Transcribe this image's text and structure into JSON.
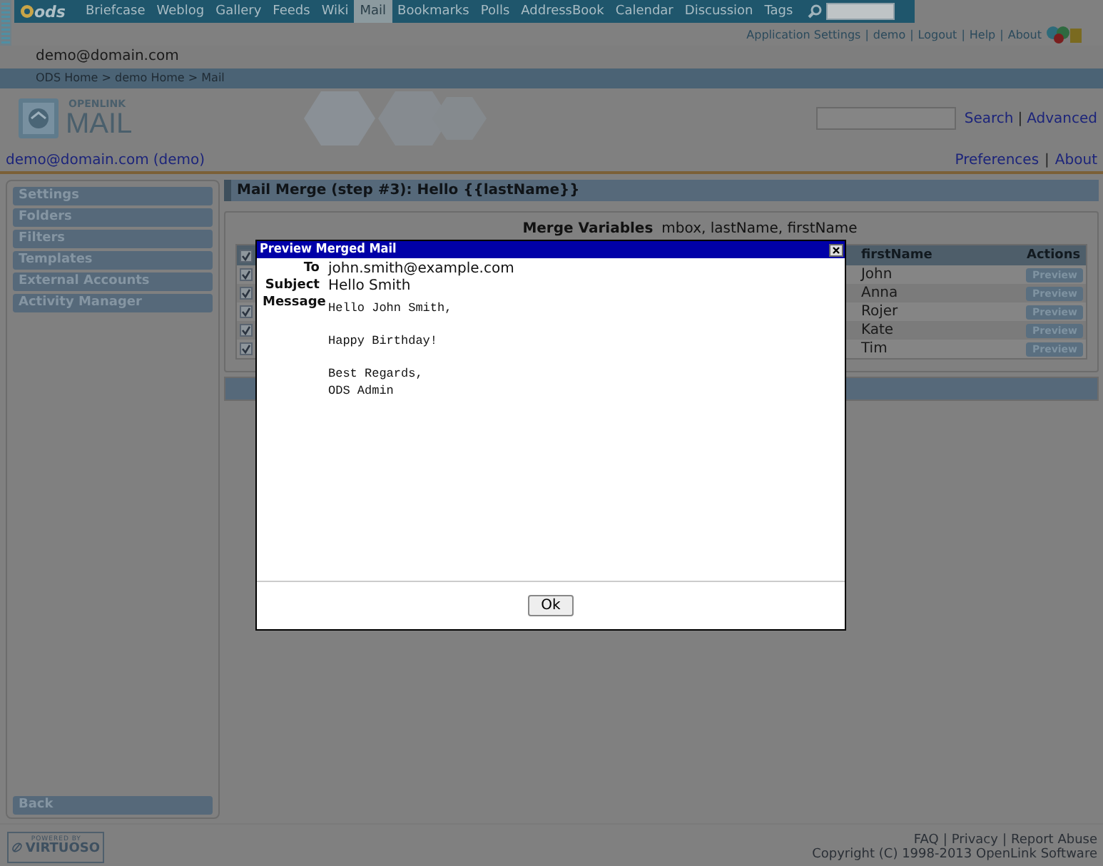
{
  "top_nav": {
    "logo": "ods",
    "items": [
      {
        "label": "Briefcase",
        "selected": false
      },
      {
        "label": "Weblog",
        "selected": false
      },
      {
        "label": "Gallery",
        "selected": false
      },
      {
        "label": "Feeds",
        "selected": false
      },
      {
        "label": "Wiki",
        "selected": false
      },
      {
        "label": "Mail",
        "selected": true
      },
      {
        "label": "Bookmarks",
        "selected": false
      },
      {
        "label": "Polls",
        "selected": false
      },
      {
        "label": "AddressBook",
        "selected": false
      },
      {
        "label": "Calendar",
        "selected": false
      },
      {
        "label": "Discussion",
        "selected": false
      },
      {
        "label": "Tags",
        "selected": false
      }
    ]
  },
  "user_links": {
    "separator": "|",
    "items": [
      "Application Settings",
      "demo",
      "Logout",
      "Help",
      "About"
    ]
  },
  "user_email": "demo@domain.com",
  "breadcrumb": "ODS Home > demo Home > Mail",
  "app_logo": {
    "brand": "OPENLINK",
    "name": "MAIL"
  },
  "header_search": {
    "separator": "|",
    "button": "Search",
    "advanced": "Advanced"
  },
  "account": {
    "email": "demo@domain.com",
    "user": "(demo)"
  },
  "header_links": {
    "separator": "|",
    "items": [
      "Preferences",
      "About"
    ]
  },
  "sidebar": {
    "items": [
      "Settings",
      "Folders",
      "Filters",
      "Templates",
      "External Accounts",
      "Activity Manager"
    ],
    "back": "Back"
  },
  "main": {
    "title": "Mail Merge (step #3): Hello {{lastName}}",
    "merge_variables_label": "Merge Variables",
    "merge_variables": "mbox, lastName, firstName",
    "table": {
      "header_checked": true,
      "columns": [
        "firstName",
        "Actions"
      ],
      "rows": [
        {
          "checked": true,
          "firstName": "John",
          "action": "Preview"
        },
        {
          "checked": true,
          "firstName": "Anna",
          "action": "Preview"
        },
        {
          "checked": true,
          "firstName": "Rojer",
          "action": "Preview"
        },
        {
          "checked": true,
          "firstName": "Kate",
          "action": "Preview"
        },
        {
          "checked": true,
          "firstName": "Tim",
          "action": "Preview"
        }
      ]
    }
  },
  "dialog": {
    "title": "Preview Merged Mail",
    "fields": [
      {
        "label": "To",
        "value": "john.smith@example.com"
      },
      {
        "label": "Subject",
        "value": "Hello Smith"
      }
    ],
    "message_label": "Message",
    "message": "Hello John Smith,\n\nHappy Birthday!\n\nBest Regards,\nODS Admin",
    "button": "Ok"
  },
  "footer": {
    "badge": {
      "top": "POWERED BY",
      "name": "VIRTUOSO"
    },
    "separator": "|",
    "links": [
      "FAQ",
      "Privacy",
      "Report Abuse"
    ],
    "copyright": "Copyright (C) 1998-2013 OpenLink Software"
  }
}
